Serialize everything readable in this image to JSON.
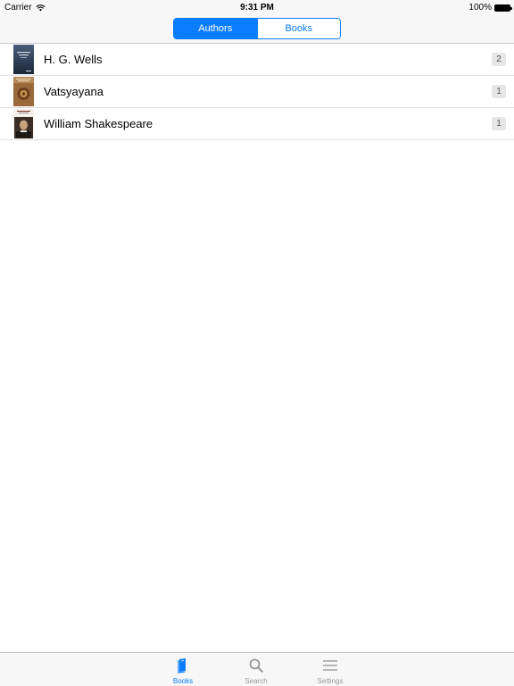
{
  "status_bar": {
    "carrier": "Carrier",
    "time": "9:31 PM",
    "battery": "100%"
  },
  "segments": [
    {
      "label": "Authors",
      "selected": true
    },
    {
      "label": "Books",
      "selected": false
    }
  ],
  "authors": [
    {
      "name": "H. G. Wells",
      "count": "2",
      "cover": "dark-blue-book-cover"
    },
    {
      "name": "Vatsyayana",
      "count": "1",
      "cover": "brown-book-cover"
    },
    {
      "name": "William Shakespeare",
      "count": "1",
      "cover": "portrait-book-cover"
    }
  ],
  "tabs": [
    {
      "label": "Books",
      "icon": "book-icon",
      "active": true
    },
    {
      "label": "Search",
      "icon": "search-icon",
      "active": false
    },
    {
      "label": "Settings",
      "icon": "menu-icon",
      "active": false
    }
  ],
  "colors": {
    "accent": "#0a7cff",
    "bar_background": "#f7f7f7",
    "badge_background": "#e6e6e6"
  }
}
